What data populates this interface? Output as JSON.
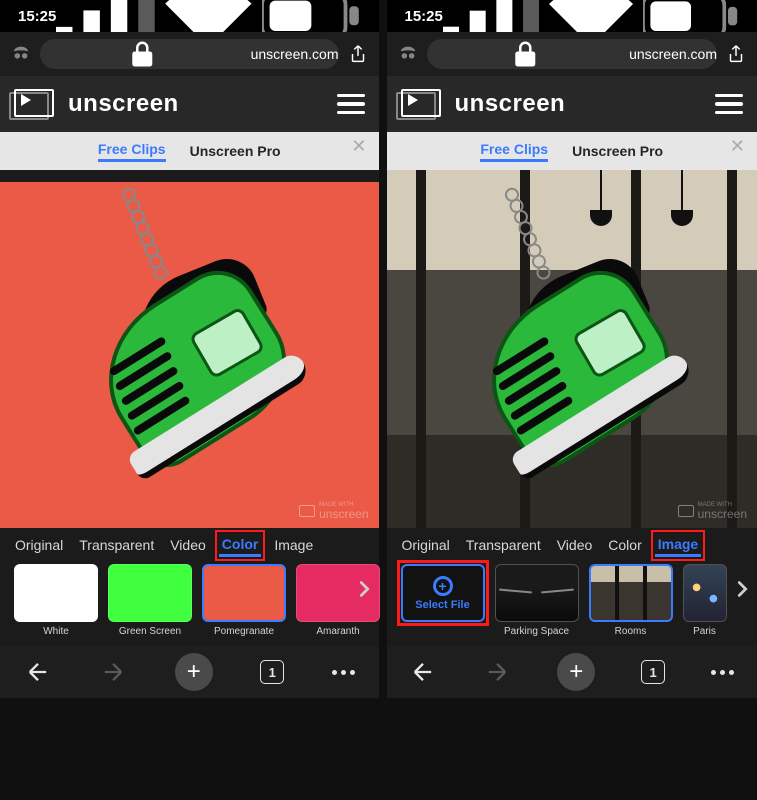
{
  "status": {
    "time": "15:25"
  },
  "browser": {
    "domain": "unscreen.com",
    "tab_count": "1"
  },
  "header": {
    "brand": "unscreen"
  },
  "nav": {
    "free_clips": "Free Clips",
    "pro": "Unscreen Pro"
  },
  "watermark": {
    "prefix": "MADE WITH",
    "name": "unscreen"
  },
  "bg_tabs": {
    "original": "Original",
    "transparent": "Transparent",
    "video": "Video",
    "color": "Color",
    "image": "Image"
  },
  "color_swatches": [
    {
      "key": "white",
      "label": "White"
    },
    {
      "key": "green",
      "label": "Green Screen"
    },
    {
      "key": "pomeg",
      "label": "Pomegranate"
    },
    {
      "key": "amaranth",
      "label": "Amaranth"
    }
  ],
  "image_swatches": {
    "select_file": "Select File",
    "items": [
      {
        "key": "garage",
        "label": "Parking Space"
      },
      {
        "key": "rooms",
        "label": "Rooms"
      },
      {
        "key": "paris",
        "label": "Paris"
      }
    ]
  }
}
